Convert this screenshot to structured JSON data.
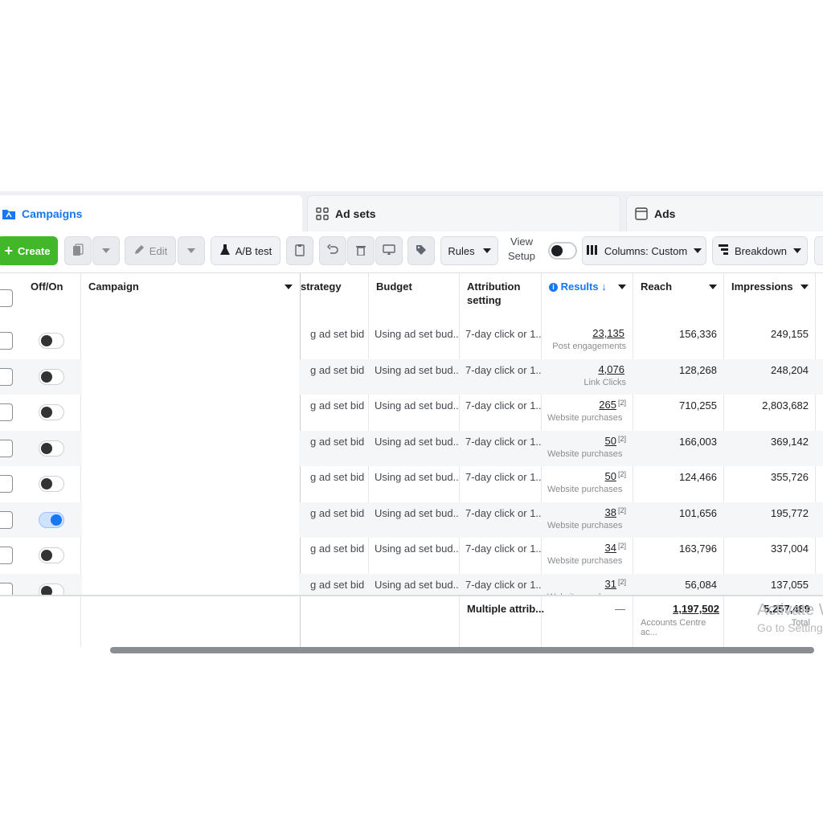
{
  "tabs": [
    {
      "label": "Campaigns",
      "icon": "campaign-folder-icon"
    },
    {
      "label": "Ad sets",
      "icon": "grid-icon"
    },
    {
      "label": "Ads",
      "icon": "ad-frame-icon"
    }
  ],
  "toolbar": {
    "create_label": "Create",
    "edit_label": "Edit",
    "ab_test_label": "A/B test",
    "rules_label": "Rules",
    "view_setup_line1": "View",
    "view_setup_line2": "Setup",
    "columns_label": "Columns: Custom",
    "breakdown_label": "Breakdown"
  },
  "columns": {
    "off_on": "Off/On",
    "campaign": "Campaign",
    "strategy": "strategy",
    "budget": "Budget",
    "attribution_line1": "Attribution",
    "attribution_line2": "setting",
    "results": "Results",
    "reach": "Reach",
    "impressions": "Impressions"
  },
  "rows": [
    {
      "on": false,
      "strategy": "g ad set bid ...",
      "budget": "Using ad set bud...",
      "attribution": "7-day click or 1...",
      "result": "23,135",
      "result_badge": "",
      "result_type": "Post engagements",
      "reach": "156,336",
      "impressions": "249,155"
    },
    {
      "on": false,
      "strategy": "g ad set bid ...",
      "budget": "Using ad set bud...",
      "attribution": "7-day click or 1...",
      "result": "4,076",
      "result_badge": "",
      "result_type": "Link Clicks",
      "reach": "128,268",
      "impressions": "248,204"
    },
    {
      "on": false,
      "strategy": "g ad set bid ...",
      "budget": "Using ad set bud...",
      "attribution": "7-day click or 1...",
      "result": "265",
      "result_badge": "[2]",
      "result_type": "Website purchases",
      "reach": "710,255",
      "impressions": "2,803,682"
    },
    {
      "on": false,
      "strategy": "g ad set bid ...",
      "budget": "Using ad set bud...",
      "attribution": "7-day click or 1...",
      "result": "50",
      "result_badge": "[2]",
      "result_type": "Website purchases",
      "reach": "166,003",
      "impressions": "369,142"
    },
    {
      "on": false,
      "strategy": "g ad set bid ...",
      "budget": "Using ad set bud...",
      "attribution": "7-day click or 1...",
      "result": "50",
      "result_badge": "[2]",
      "result_type": "Website purchases",
      "reach": "124,466",
      "impressions": "355,726"
    },
    {
      "on": true,
      "strategy": "g ad set bid ...",
      "budget": "Using ad set bud...",
      "attribution": "7-day click or 1...",
      "result": "38",
      "result_badge": "[2]",
      "result_type": "Website purchases",
      "reach": "101,656",
      "impressions": "195,772"
    },
    {
      "on": false,
      "strategy": "g ad set bid ...",
      "budget": "Using ad set bud...",
      "attribution": "7-day click or 1...",
      "result": "34",
      "result_badge": "[2]",
      "result_type": "Website purchases",
      "reach": "163,796",
      "impressions": "337,004"
    },
    {
      "on": false,
      "strategy": "g ad set bid ...",
      "budget": "Using ad set bud...",
      "attribution": "7-day click or 1...",
      "result": "31",
      "result_badge": "[2]",
      "result_type": "Website purchases",
      "reach": "56,084",
      "impressions": "137,055"
    }
  ],
  "totals": {
    "attribution": "Multiple attrib...",
    "results": "—",
    "reach": "1,197,502",
    "reach_sub": "Accounts Centre ac...",
    "impressions": "5,257,489",
    "impressions_sub": "Total"
  },
  "watermark": {
    "line1": "Activate W",
    "line2": "Go to Setting"
  },
  "colors": {
    "accent": "#1877f2",
    "create_button": "#42b72a",
    "toggle_on": "#1877f2"
  }
}
